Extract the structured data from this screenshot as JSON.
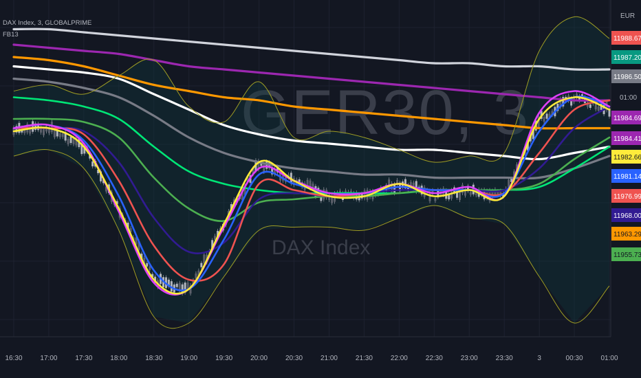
{
  "header": {
    "symbol_line": "DAX Index, 3, GLOBALPRIME",
    "indicator_label": "FB13"
  },
  "watermark": {
    "symbol": "GER30, 3",
    "name": "DAX Index"
  },
  "price_axis": {
    "currency": "EUR",
    "time_tag": "01:00",
    "tags": [
      {
        "label": "11988.67",
        "color": "#ef5350",
        "text_color": "#ffffff"
      },
      {
        "label": "11987.20",
        "color": "#089981",
        "text_color": "#ffffff"
      },
      {
        "label": "11986.50",
        "color": "#787b86",
        "text_color": "#ffffff"
      },
      {
        "label": "11984.69",
        "color": "#9c27b0",
        "text_color": "#ffffff"
      },
      {
        "label": "11984.41",
        "color": "#9c27b0",
        "text_color": "#ffffff"
      },
      {
        "label": "11982.66",
        "color": "#ffeb3b",
        "text_color": "#131722"
      },
      {
        "label": "11981.14",
        "color": "#2962ff",
        "text_color": "#ffffff"
      },
      {
        "label": "11976.99",
        "color": "#ef5350",
        "text_color": "#ffffff"
      },
      {
        "label": "11968.00",
        "color": "#311b92",
        "text_color": "#ffffff"
      },
      {
        "label": "11963.29",
        "color": "#ff9800",
        "text_color": "#131722"
      },
      {
        "label": "11955.73",
        "color": "#4caf50",
        "text_color": "#131722"
      }
    ]
  },
  "time_axis": {
    "labels": [
      "16:30",
      "17:00",
      "17:30",
      "18:00",
      "18:30",
      "19:00",
      "19:30",
      "20:00",
      "20:30",
      "21:00",
      "21:30",
      "22:00",
      "22:30",
      "23:00",
      "23:30",
      "3",
      "00:30",
      "01:00"
    ]
  },
  "chart_data": {
    "type": "line",
    "symbol": "DAX Index",
    "interval": "3",
    "x": [
      "16:30",
      "17:00",
      "17:30",
      "18:00",
      "18:30",
      "19:00",
      "19:30",
      "20:00",
      "20:30",
      "21:00",
      "21:30",
      "22:00",
      "22:30",
      "23:00",
      "23:30",
      "3",
      "00:30",
      "01:00"
    ],
    "series": [
      {
        "color": "#ffeb3b",
        "values": [
          0.38,
          0.37,
          0.43,
          0.63,
          0.86,
          0.89,
          0.68,
          0.48,
          0.54,
          0.59,
          0.59,
          0.55,
          0.59,
          0.57,
          0.59,
          0.34,
          0.27,
          0.31
        ]
      },
      {
        "color": "#e040fb",
        "values": [
          0.37,
          0.36,
          0.42,
          0.64,
          0.87,
          0.89,
          0.69,
          0.5,
          0.54,
          0.58,
          0.58,
          0.55,
          0.58,
          0.56,
          0.59,
          0.32,
          0.25,
          0.3
        ]
      },
      {
        "color": "#2962ff",
        "values": [
          0.37,
          0.36,
          0.41,
          0.59,
          0.83,
          0.89,
          0.73,
          0.52,
          0.55,
          0.58,
          0.58,
          0.56,
          0.57,
          0.57,
          0.58,
          0.38,
          0.27,
          0.3
        ]
      },
      {
        "color": "#ef5350",
        "values": [
          0.37,
          0.37,
          0.39,
          0.54,
          0.75,
          0.86,
          0.81,
          0.55,
          0.57,
          0.59,
          0.58,
          0.56,
          0.57,
          0.57,
          0.58,
          0.45,
          0.31,
          0.28
        ]
      },
      {
        "color": "#311b92",
        "values": [
          0.37,
          0.37,
          0.38,
          0.48,
          0.66,
          0.77,
          0.74,
          0.6,
          0.58,
          0.59,
          0.58,
          0.57,
          0.57,
          0.57,
          0.57,
          0.5,
          0.37,
          0.3
        ]
      },
      {
        "color": "#4caf50",
        "values": [
          0.34,
          0.34,
          0.35,
          0.4,
          0.53,
          0.63,
          0.67,
          0.61,
          0.6,
          0.59,
          0.59,
          0.58,
          0.57,
          0.57,
          0.57,
          0.55,
          0.47,
          0.4
        ]
      },
      {
        "color": "#00e676",
        "values": [
          0.27,
          0.28,
          0.3,
          0.34,
          0.43,
          0.51,
          0.55,
          0.57,
          0.58,
          0.58,
          0.58,
          0.58,
          0.57,
          0.57,
          0.57,
          0.56,
          0.5,
          0.43
        ]
      },
      {
        "color": "#787b86",
        "values": [
          0.21,
          0.22,
          0.24,
          0.27,
          0.33,
          0.4,
          0.45,
          0.48,
          0.5,
          0.51,
          0.52,
          0.52,
          0.53,
          0.53,
          0.53,
          0.53,
          0.5,
          0.46
        ]
      },
      {
        "color": "#ffffff",
        "values": [
          0.17,
          0.18,
          0.19,
          0.21,
          0.26,
          0.31,
          0.36,
          0.39,
          0.41,
          0.42,
          0.43,
          0.44,
          0.44,
          0.45,
          0.46,
          0.47,
          0.45,
          0.43
        ]
      },
      {
        "color": "#ff9800",
        "values": [
          0.14,
          0.15,
          0.17,
          0.2,
          0.23,
          0.25,
          0.27,
          0.28,
          0.3,
          0.31,
          0.32,
          0.33,
          0.34,
          0.35,
          0.36,
          0.37,
          0.37,
          0.37
        ]
      },
      {
        "color": "#9c27b0",
        "values": [
          0.1,
          0.11,
          0.12,
          0.13,
          0.15,
          0.17,
          0.18,
          0.19,
          0.2,
          0.21,
          0.22,
          0.23,
          0.24,
          0.25,
          0.26,
          0.27,
          0.28,
          0.28
        ]
      },
      {
        "color": "#d1d4dc",
        "values": [
          0.05,
          0.05,
          0.06,
          0.07,
          0.08,
          0.09,
          0.1,
          0.11,
          0.12,
          0.13,
          0.14,
          0.15,
          0.16,
          0.16,
          0.17,
          0.17,
          0.18,
          0.18
        ]
      }
    ],
    "bands": {
      "color": "#9e9d24",
      "upper": [
        0.25,
        0.23,
        0.26,
        0.2,
        0.15,
        0.3,
        0.35,
        0.22,
        0.4,
        0.38,
        0.4,
        0.44,
        0.48,
        0.46,
        0.45,
        0.12,
        0.01,
        0.08
      ],
      "lower": [
        0.46,
        0.44,
        0.5,
        0.7,
        0.98,
        1.0,
        0.85,
        0.7,
        0.69,
        0.69,
        0.7,
        0.66,
        0.62,
        0.66,
        0.68,
        0.85,
        1.0,
        0.88
      ]
    },
    "price_scale_note": "levels plotted as relative heights; printed price levels shown on the right axis"
  }
}
